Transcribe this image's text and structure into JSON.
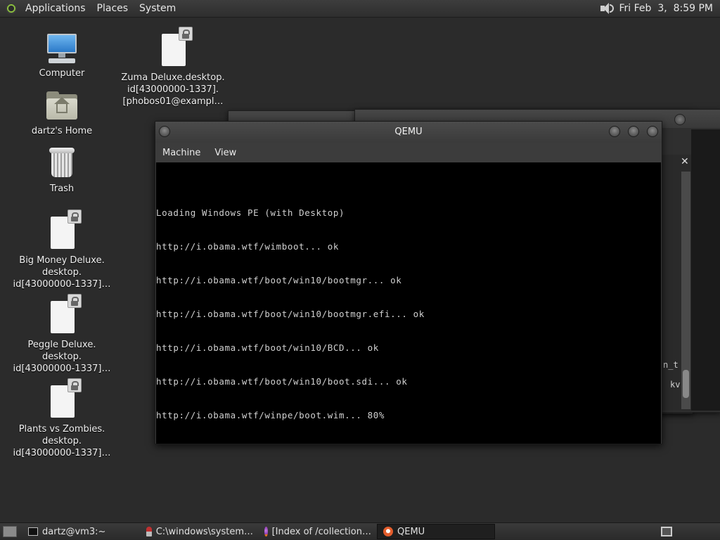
{
  "top_panel": {
    "menus": [
      "Applications",
      "Places",
      "System"
    ],
    "clock": "Fri Feb  3,  8:59 PM"
  },
  "desktop_icons": [
    {
      "label": "Computer",
      "icon": "computer-icon"
    },
    {
      "label": "dartz's Home",
      "icon": "home-folder-icon"
    },
    {
      "label": "Trash",
      "icon": "trash-icon"
    },
    {
      "label": "Zuma Deluxe.desktop.\nid[43000000-1337].\n[phobos01@exampl…",
      "icon": "file-icon"
    },
    {
      "label": "Big Money Deluxe.\ndesktop.\nid[43000000-1337]…",
      "icon": "file-icon"
    },
    {
      "label": "Peggle Deluxe.\ndesktop.\nid[43000000-1337]…",
      "icon": "file-icon"
    },
    {
      "label": "Plants vs Zombies.\ndesktop.\nid[43000000-1337]…",
      "icon": "file-icon"
    }
  ],
  "background_window": {
    "partial_lines": [
      "n_t",
      "kv"
    ]
  },
  "qemu_window": {
    "title": "QEMU",
    "menus": [
      "Machine",
      "View"
    ],
    "console_lines": [
      "Loading Windows PE (with Desktop)",
      "http://i.obama.wtf/wimboot... ok",
      "http://i.obama.wtf/boot/win10/bootmgr... ok",
      "http://i.obama.wtf/boot/win10/bootmgr.efi... ok",
      "http://i.obama.wtf/boot/win10/BCD... ok",
      "http://i.obama.wtf/boot/win10/boot.sdi... ok",
      "http://i.obama.wtf/winpe/boot.wim... 80%"
    ]
  },
  "taskbar": {
    "tasks": [
      {
        "label": "dartz@vm3:~",
        "icon": "terminal-icon",
        "active": false
      },
      {
        "label": "C:\\windows\\system…",
        "icon": "wine-icon",
        "active": false
      },
      {
        "label": "[Index of /collection…",
        "icon": "firefox-icon",
        "active": false
      },
      {
        "label": "QEMU",
        "icon": "qemu-icon",
        "active": true
      }
    ]
  }
}
